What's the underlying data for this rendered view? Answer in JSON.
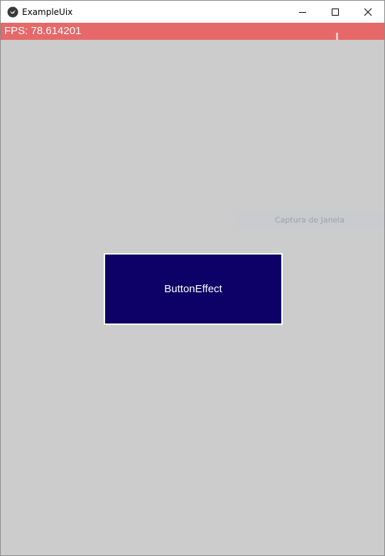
{
  "window": {
    "title": "ExampleUix",
    "icon": "kivy-icon",
    "controls": [
      "minimize-icon",
      "maximize-icon",
      "close-icon"
    ]
  },
  "fps": {
    "text": "FPS: 78.614201"
  },
  "capture": {
    "label": "Captura de Janela"
  },
  "button": {
    "label": "ButtonEffect"
  },
  "colors": {
    "background": "#cccccc",
    "fps_bar": "#e66868",
    "button_fill": "#0d0066",
    "button_border": "#ffffff"
  }
}
